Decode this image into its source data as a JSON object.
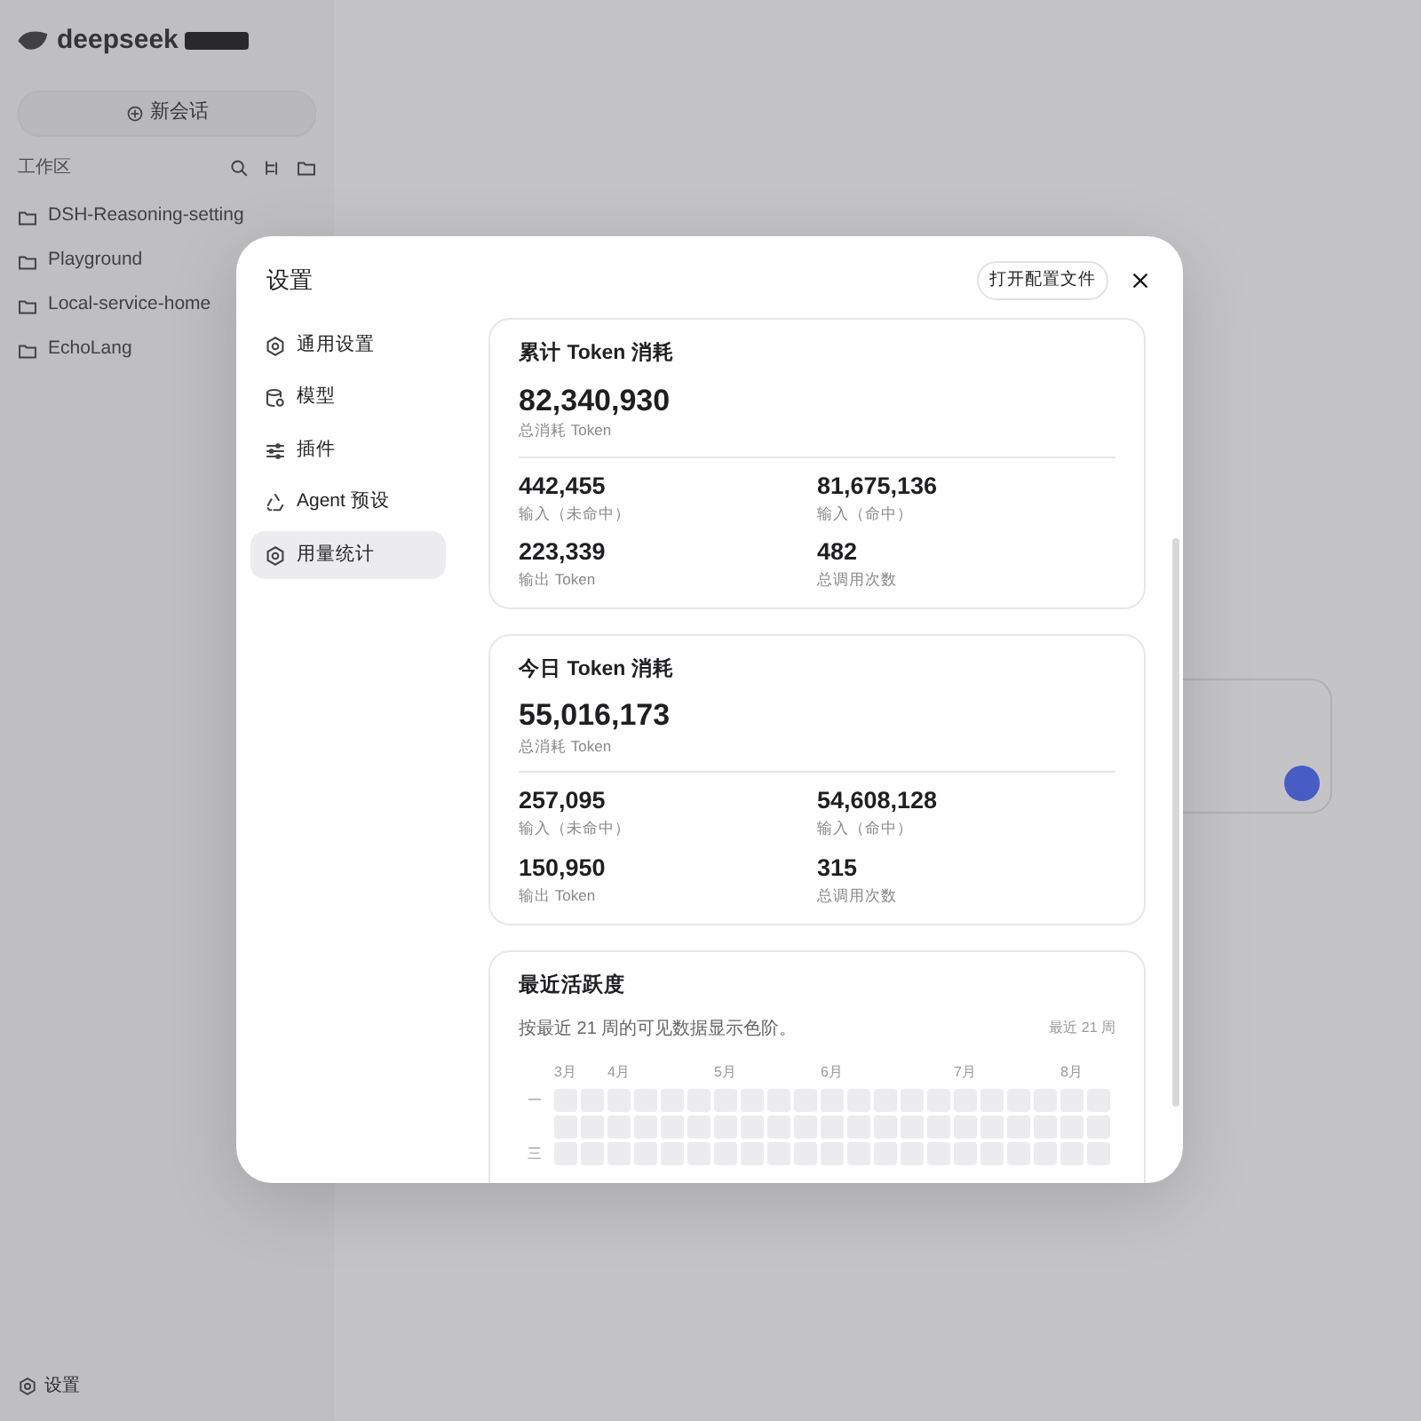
{
  "sidebar": {
    "logo": "deepseek",
    "new_chat": "新会话",
    "workspace_label": "工作区",
    "folders": [
      {
        "name": "DSH-Reasoning-setting"
      },
      {
        "name": "Playground"
      },
      {
        "name": "Local-service-home"
      },
      {
        "name": "EchoLang"
      }
    ],
    "settings": "设置"
  },
  "dialog": {
    "title": "设置",
    "open_config_button": "打开配置文件",
    "nav": [
      {
        "kind": "general",
        "label": "通用设置",
        "selected": false
      },
      {
        "kind": "model",
        "label": "模型",
        "selected": false
      },
      {
        "kind": "plugin",
        "label": "插件",
        "selected": false
      },
      {
        "kind": "agent",
        "label": "Agent 预设",
        "selected": false
      },
      {
        "kind": "usage",
        "label": "用量统计",
        "selected": true
      }
    ],
    "cards": [
      {
        "kind": "stats",
        "title": "累计 Token 消耗",
        "total": "82,340,930",
        "total_label": "总消耗 Token",
        "stats": [
          {
            "value": "442,455",
            "label": "输入（未命中）"
          },
          {
            "value": "81,675,136",
            "label": "输入（命中）"
          },
          {
            "value": "223,339",
            "label": "输出 Token"
          },
          {
            "value": "482",
            "label": "总调用次数"
          }
        ]
      },
      {
        "kind": "stats",
        "title": "今日 Token 消耗",
        "total": "55,016,173",
        "total_label": "总消耗 Token",
        "stats": [
          {
            "value": "257,095",
            "label": "输入（未命中）"
          },
          {
            "value": "54,608,128",
            "label": "输入（命中）"
          },
          {
            "value": "150,950",
            "label": "输出 Token"
          },
          {
            "value": "315",
            "label": "总调用次数"
          }
        ]
      },
      {
        "kind": "heatmap",
        "title": "最近活跃度",
        "description": "按最近 21 周的可见数据显示色阶。",
        "range_label": "最近 21 周",
        "columns": [
          {
            "month": "3月"
          },
          {},
          {
            "month": "4月"
          },
          {},
          {},
          {},
          {
            "month": "5月"
          },
          {},
          {},
          {},
          {
            "month": "6月"
          },
          {},
          {},
          {},
          {},
          {
            "month": "7月"
          },
          {},
          {},
          {},
          {
            "month": "8月"
          },
          {}
        ],
        "rows": [
          {
            "label": "一"
          },
          {},
          {
            "label": "三"
          }
        ]
      }
    ]
  }
}
